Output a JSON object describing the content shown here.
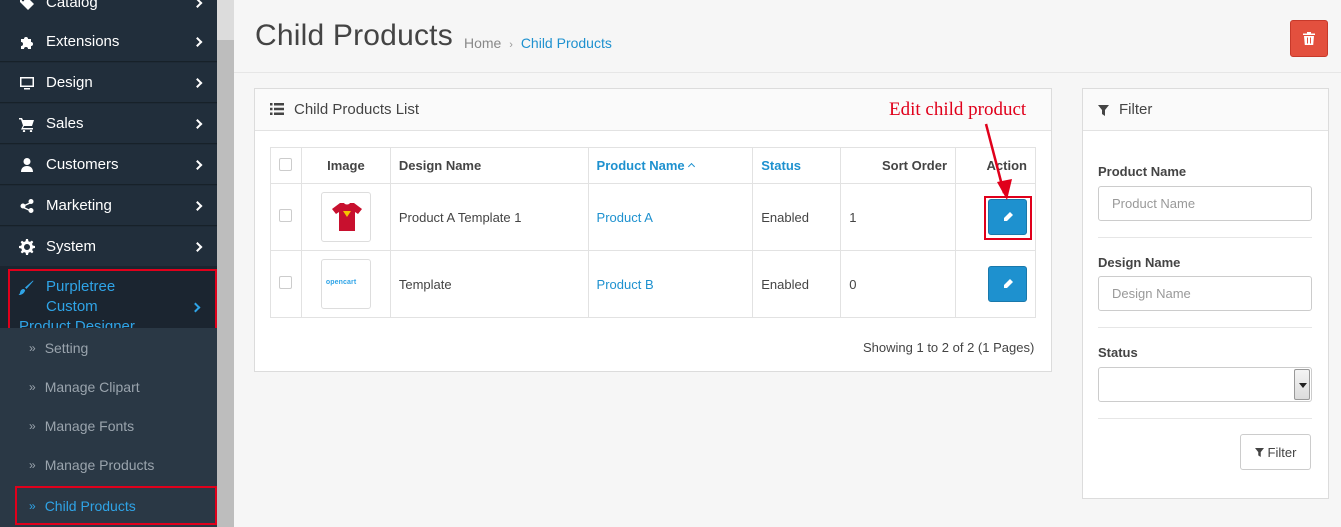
{
  "sidebar": {
    "items": [
      {
        "label": "Catalog",
        "icon": "tag-icon"
      },
      {
        "label": "Extensions",
        "icon": "puzzle-icon"
      },
      {
        "label": "Design",
        "icon": "monitor-icon"
      },
      {
        "label": "Sales",
        "icon": "cart-icon"
      },
      {
        "label": "Customers",
        "icon": "user-icon"
      },
      {
        "label": "Marketing",
        "icon": "share-icon"
      },
      {
        "label": "System",
        "icon": "gear-icon"
      }
    ],
    "active": {
      "label_line1": "Purpletree Custom",
      "label_line2": "Product Designer",
      "icon": "brush-icon"
    },
    "subitems": [
      {
        "label": "Setting"
      },
      {
        "label": "Manage Clipart"
      },
      {
        "label": "Manage Fonts"
      },
      {
        "label": "Manage Products"
      },
      {
        "label": "Child Products"
      }
    ]
  },
  "header": {
    "title": "Child Products",
    "breadcrumb_home": "Home",
    "breadcrumb_sep": "›",
    "breadcrumb_current": "Child Products"
  },
  "list": {
    "title": "Child Products List",
    "columns": {
      "image": "Image",
      "design_name": "Design Name",
      "product_name": "Product Name",
      "status": "Status",
      "sort_order": "Sort Order",
      "action": "Action"
    },
    "rows": [
      {
        "design_name": "Product A Template 1",
        "product_name": "Product A",
        "status": "Enabled",
        "sort_order": "1",
        "thumb": "tshirt"
      },
      {
        "design_name": "Template",
        "product_name": "Product B",
        "status": "Enabled",
        "sort_order": "0",
        "thumb": "opencart",
        "thumb_text": "opencart"
      }
    ],
    "pagination_text": "Showing 1 to 2 of 2 (1 Pages)"
  },
  "annotation": "Edit child product",
  "filter": {
    "title": "Filter",
    "product_name_label": "Product Name",
    "product_name_placeholder": "Product Name",
    "design_name_label": "Design Name",
    "design_name_placeholder": "Design Name",
    "status_label": "Status",
    "status_value": "",
    "button_label": "Filter"
  },
  "colors": {
    "accent": "#1e91cf",
    "danger": "#e3503e",
    "annotation": "#e0001b",
    "sidebar_bg": "#212e3b"
  }
}
